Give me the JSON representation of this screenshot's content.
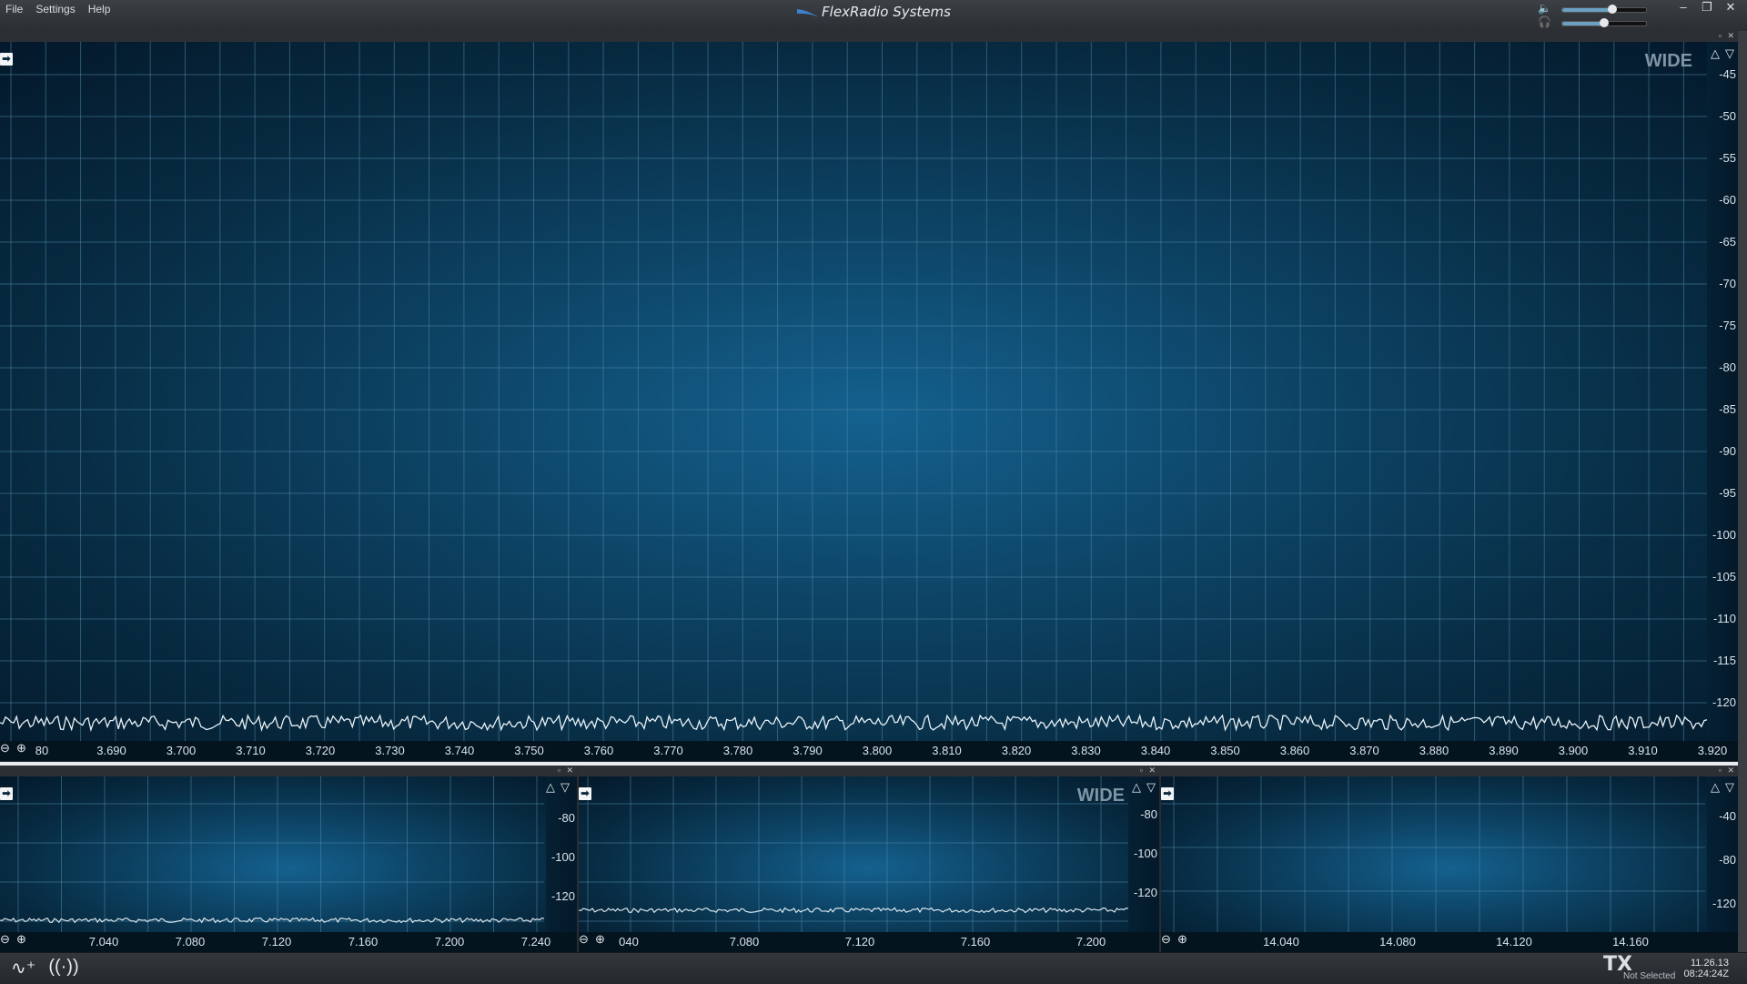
{
  "menu": [
    "File",
    "Settings",
    "Help"
  ],
  "app_title": "FlexRadio Systems",
  "window_buttons": [
    "–",
    "❐",
    "✕"
  ],
  "main_pan": {
    "mode_label": "WIDE",
    "dbm_ticks": [
      "-45",
      "-50",
      "-55",
      "-60",
      "-65",
      "-70",
      "-75",
      "-80",
      "-85",
      "-90",
      "-95",
      "-100",
      "-105",
      "-110",
      "-115",
      "-120"
    ],
    "freq_ticks": [
      "80",
      "3.690",
      "3.700",
      "3.710",
      "3.720",
      "3.730",
      "3.740",
      "3.750",
      "3.760",
      "3.770",
      "3.780",
      "3.790",
      "3.800",
      "3.810",
      "3.820",
      "3.830",
      "3.840",
      "3.850",
      "3.860",
      "3.870",
      "3.880",
      "3.890",
      "3.900",
      "3.910",
      "3.920"
    ]
  },
  "pan_40m": {
    "dbm_ticks": [
      "-80",
      "-100",
      "-120"
    ],
    "freq_ticks": [
      "7.040",
      "7.080",
      "7.120",
      "7.160",
      "7.200",
      "7.240"
    ]
  },
  "pan_40m_b": {
    "mode_label": "WIDE",
    "dbm_ticks": [
      "-80",
      "-100",
      "-120"
    ],
    "freq_ticks": [
      "040",
      "7.080",
      "7.120",
      "7.160",
      "7.200"
    ]
  },
  "pan_20m": {
    "dbm_ticks": [
      "-40",
      "-80",
      "-120"
    ],
    "freq_ticks": [
      "14.040",
      "14.080",
      "14.120",
      "14.160"
    ]
  },
  "status": {
    "tx_label": "TX",
    "tx_sub": "Not Selected",
    "date": "11.26.13",
    "time": "08:24:24Z"
  },
  "colors": {
    "trace": "#e8f2f8",
    "accent": "#14618f"
  }
}
